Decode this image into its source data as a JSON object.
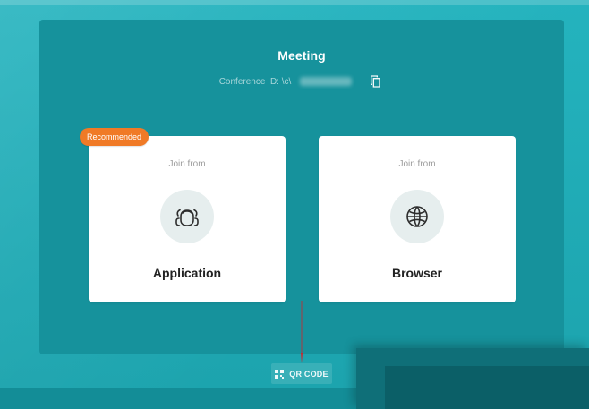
{
  "meeting": {
    "title": "Meeting",
    "conference_label": "Conference ID: \\c\\"
  },
  "badge": {
    "text": "Recommended"
  },
  "cards": {
    "application": {
      "join_from": "Join from",
      "label": "Application",
      "icon": "users-group-icon"
    },
    "browser": {
      "join_from": "Join from",
      "label": "Browser",
      "icon": "globe-icon"
    }
  },
  "qr": {
    "label": "QR CODE",
    "icon": "qr-code-icon"
  },
  "colors": {
    "panel": "#16929c",
    "background": "#21aab6",
    "badge": "#f07a26",
    "arrow": "#d0242a"
  }
}
